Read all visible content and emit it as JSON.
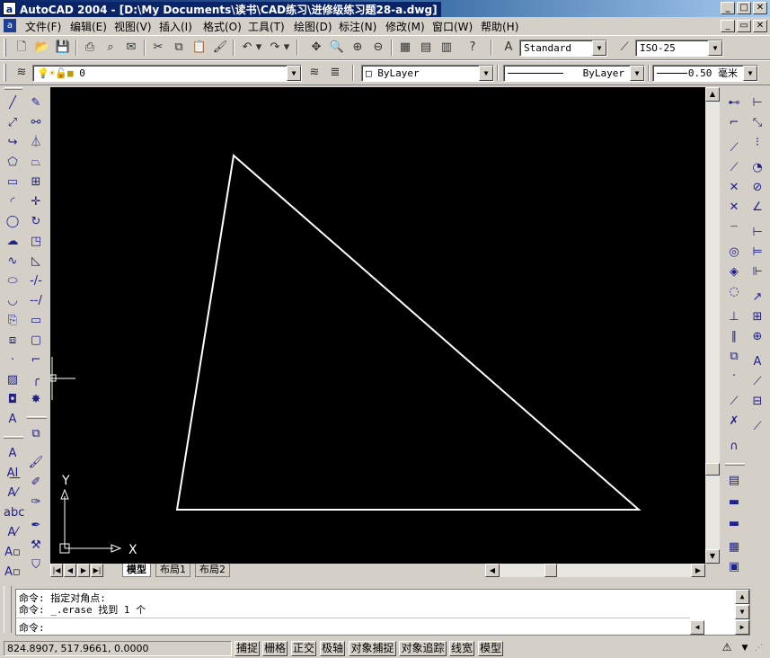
{
  "window": {
    "title": "AutoCAD 2004 - [D:\\My Documents\\读书\\CAD练习\\进修级练习题28-a.dwg]",
    "minimize_icon": "minimize-glyph",
    "maximize_icon": "maximize-glyph",
    "close_icon": "close-glyph"
  },
  "menu": [
    "文件(F)",
    "编辑(E)",
    "视图(V)",
    "插入(I)",
    "格式(O)",
    "工具(T)",
    "绘图(D)",
    "标注(N)",
    "修改(M)",
    "窗口(W)",
    "帮助(H)"
  ],
  "styles": {
    "text_style": "Standard",
    "dim_style": "ISO-25"
  },
  "layers": {
    "current_layer": "0",
    "color": "ByLayer",
    "linetype": "ByLayer",
    "lineweight": "0.50 毫米"
  },
  "drawing": {
    "ucs_x": "X",
    "ucs_y": "Y",
    "line_color": "#ffffff",
    "background": "#000000"
  },
  "layout_tabs": [
    "模型",
    "布局1",
    "布局2"
  ],
  "command": {
    "lines": [
      "命令: 指定对角点:",
      "命令: _.erase 找到 1 个"
    ],
    "prompt": "命令:"
  },
  "status": {
    "coords": "824.8907, 517.9661, 0.0000",
    "toggles": [
      {
        "label": "捕捉",
        "on": false
      },
      {
        "label": "栅格",
        "on": false
      },
      {
        "label": "正交",
        "on": false
      },
      {
        "label": "极轴",
        "on": false
      },
      {
        "label": "对象捕捉",
        "on": false
      },
      {
        "label": "对象追踪",
        "on": false
      },
      {
        "label": "线宽",
        "on": false
      },
      {
        "label": "模型",
        "on": false
      }
    ]
  }
}
